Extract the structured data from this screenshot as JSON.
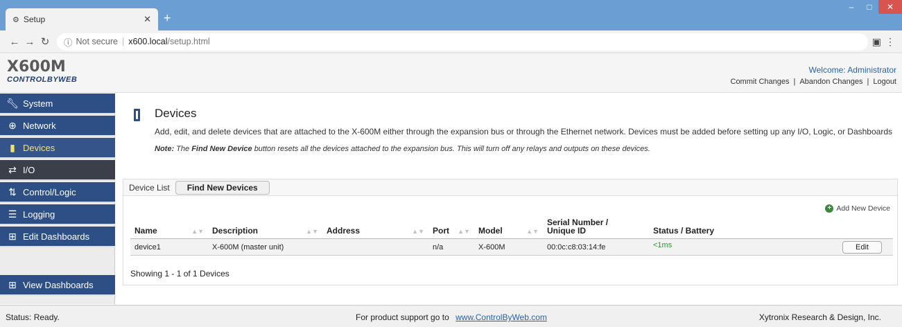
{
  "browser": {
    "tab_title": "Setup",
    "tab_favicon": "⚙",
    "address": {
      "security": "Not secure",
      "host": "x600.local",
      "path": "/setup.html"
    }
  },
  "header": {
    "logo_main": "X600M",
    "logo_sub": "CONTROLBYWEB",
    "welcome": "Welcome: Administrator",
    "links": [
      "Commit Changes",
      "Abandon Changes",
      "Logout"
    ]
  },
  "sidebar": {
    "items": [
      {
        "label": "System",
        "icon": "wrench-icon"
      },
      {
        "label": "Network",
        "icon": "globe-icon"
      },
      {
        "label": "Devices",
        "icon": "device-icon"
      },
      {
        "label": "I/O",
        "icon": "arrows-icon"
      },
      {
        "label": "Control/Logic",
        "icon": "logic-icon"
      },
      {
        "label": "Logging",
        "icon": "log-icon"
      },
      {
        "label": "Edit Dashboards",
        "icon": "dashboard-icon"
      }
    ],
    "view_dashboards": "View Dashboards"
  },
  "main": {
    "title": "Devices",
    "description": "Add, edit, and delete devices that are attached to the X-600M either through the expansion bus or through the Ethernet network. Devices must be added before setting up any I/O, Logic, or Dashboards",
    "note_prefix": "Note:",
    "note_the": "The",
    "note_bold": "Find New Device",
    "note_rest": "button resets all the devices attached to the expansion bus. This will turn off any relays and outputs on these devices.",
    "panel": {
      "tab_label": "Device List",
      "find_button": "Find New Devices",
      "add_new": "Add New Device",
      "columns": [
        "Name",
        "Description",
        "Address",
        "Port",
        "Model",
        "Serial Number / Unique ID",
        "Status / Battery"
      ],
      "rows": [
        {
          "name": "device1",
          "description": "X-600M (master unit)",
          "address": "",
          "port": "n/a",
          "model": "X-600M",
          "serial": "00:0c:c8:03:14:fe",
          "status": "<1ms",
          "action": "Edit"
        }
      ],
      "showing": "Showing 1 - 1 of 1 Devices"
    }
  },
  "footer": {
    "status": "Status:  Ready.",
    "support_text": "For product support go to",
    "support_link": "www.ControlByWeb.com",
    "company": "Xytronix Research & Design, Inc."
  },
  "colors": {
    "sidebar_bg": "#2d4f86",
    "active_text": "#f5e16a",
    "status_ok": "#2a9a2a",
    "link": "#2a62a8"
  }
}
